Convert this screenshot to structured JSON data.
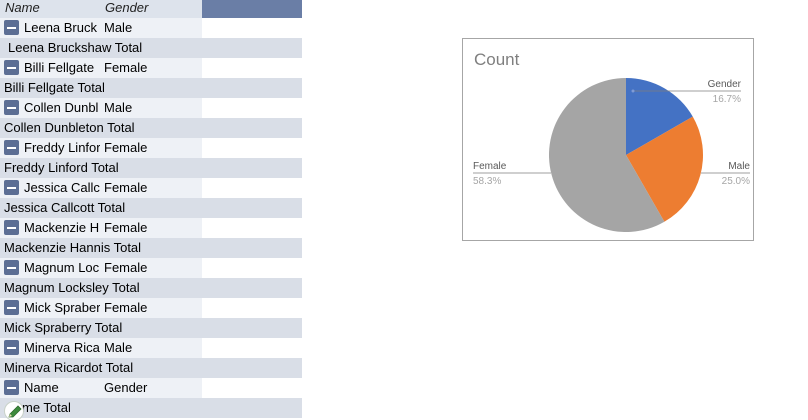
{
  "pivot": {
    "headers": {
      "name": "Name",
      "gender": "Gender"
    },
    "groups": [
      {
        "name_truncated": "Leena Bruck",
        "gender": "Male",
        "total": "Leena Bruckshaw Total"
      },
      {
        "name_truncated": "Billi Fellgate",
        "gender": "Female",
        "total": "Billi Fellgate Total"
      },
      {
        "name_truncated": "Collen Dunbl",
        "gender": "Male",
        "total": "Collen Dunbleton Total"
      },
      {
        "name_truncated": "Freddy Linfor",
        "gender": "Female",
        "total": "Freddy Linford Total"
      },
      {
        "name_truncated": "Jessica Callcc",
        "gender": "Female",
        "total": "Jessica Callcott Total"
      },
      {
        "name_truncated": "Mackenzie H",
        "gender": "Female",
        "total": "Mackenzie Hannis Total"
      },
      {
        "name_truncated": "Magnum Loc",
        "gender": "Female",
        "total": "Magnum Locksley Total"
      },
      {
        "name_truncated": "Mick Spraber",
        "gender": "Female",
        "total": "Mick Spraberry Total"
      },
      {
        "name_truncated": "Minerva Rica",
        "gender": "Male",
        "total": "Minerva Ricardot Total"
      },
      {
        "name_truncated": "Name",
        "gender": "Gender",
        "total": "me Total"
      }
    ]
  },
  "chart_data": {
    "type": "pie",
    "title": "Count",
    "slices": [
      {
        "label": "Gender",
        "percent_label": "16.7%",
        "value": 16.7,
        "color": "#4472c4"
      },
      {
        "label": "Male",
        "percent_label": "25.0%",
        "value": 25.0,
        "color": "#ed7d31"
      },
      {
        "label": "Female",
        "percent_label": "58.3%",
        "value": 58.3,
        "color": "#a5a5a5"
      }
    ]
  },
  "icons": {
    "edit": "pencil-icon",
    "collapse": "minus-icon"
  },
  "colors": {
    "header_dark": "#6a7ea6",
    "header_light": "#dde3ec",
    "total_row": "#d9dee7",
    "detail_row": "#eef1f6"
  }
}
